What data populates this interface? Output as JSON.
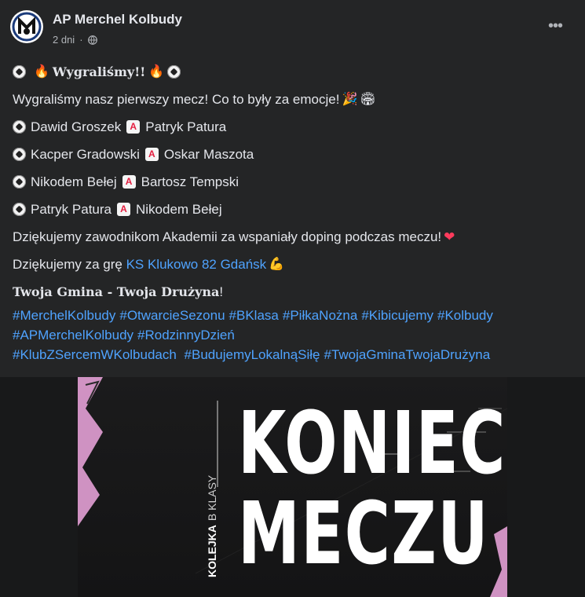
{
  "post": {
    "page_name": "AP Merchel Kolbudy",
    "time": "2 dni",
    "dot": "·",
    "privacy_icon": "globe-icon",
    "more_label": "•••",
    "headline": "Wygraliśmy!!",
    "line1": "Wygraliśmy nasz pierwszy mecz! Co to były za emocje!",
    "goals": [
      {
        "scorer": "Dawid Groszek",
        "assist": "Patryk Patura"
      },
      {
        "scorer": "Kacper Gradowski",
        "assist": "Oskar Maszota"
      },
      {
        "scorer": "Nikodem Bełej",
        "assist": "Bartosz Tempski"
      },
      {
        "scorer": "Patryk Patura",
        "assist": "Nikodem Bełej"
      }
    ],
    "assist_badge": "A",
    "thanks_academy": "Dziękujemy zawodnikom Akademii za wspaniały doping podczas meczu!",
    "thanks_game_prefix": "Dziękujemy za grę ",
    "opponent_link": "KS Klukowo 82 Gdańsk",
    "slogan_bold": "Twoja Gmina - Twoja Drużyna",
    "slogan_end": "!",
    "hashtags_row1": [
      "#MerchelKolbudy",
      "#OtwarcieSezonu",
      "#BKlasa",
      "#PiłkaNożna",
      "#Kibicujemy",
      "#Kolbudy"
    ],
    "hashtags_row2": [
      "#APMerchelKolbudy",
      "#RodzinnyDzień"
    ],
    "hashtags_row3": [
      "#KlubZSercemWKolbudach",
      " #BudujemyLokalnąSiłę",
      "#TwojaGminaTwojaDrużyna"
    ]
  },
  "image": {
    "line1": "KONIEC",
    "line2": "MECZU",
    "vertical_bold": "KOLEJKA",
    "vertical_light": "B KLASY",
    "accent_color": "#f0a8e0"
  }
}
